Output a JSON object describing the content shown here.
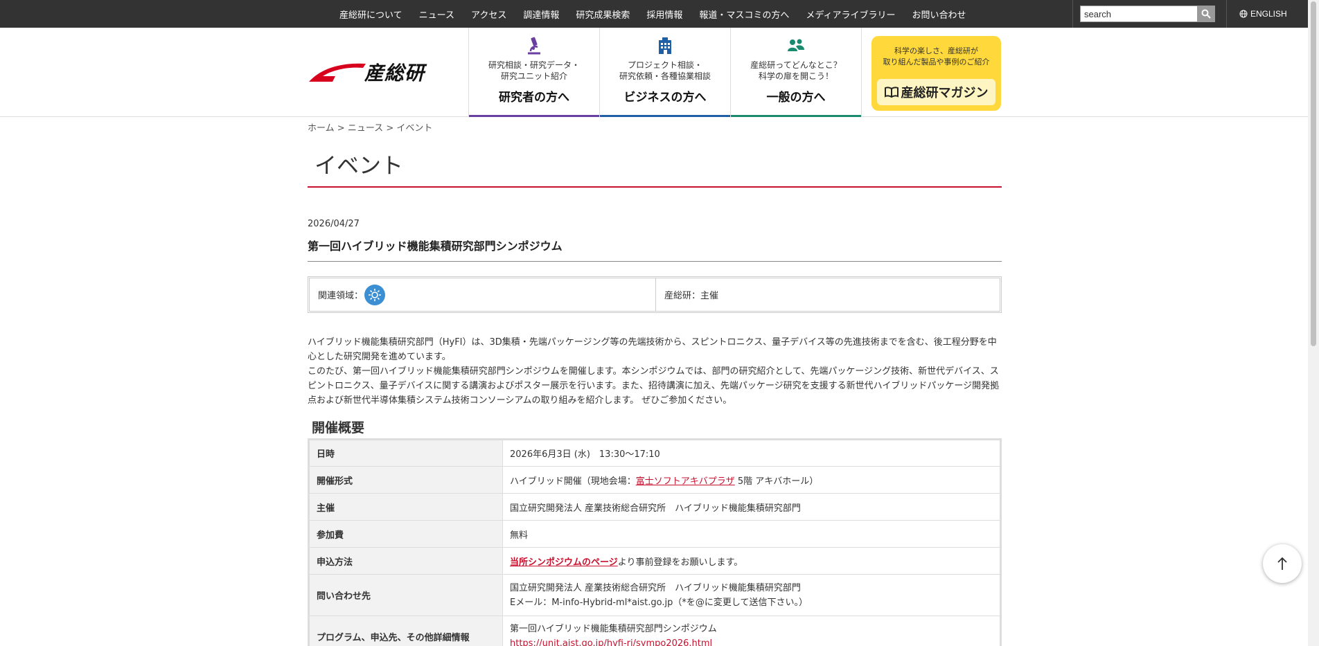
{
  "topnav": {
    "items": [
      "産総研について",
      "ニュース",
      "アクセス",
      "調達情報",
      "研究成果検索",
      "採用情報",
      "報道・マスコミの方へ",
      "メディアライブラリー",
      "お問い合わせ"
    ],
    "search_value": "search",
    "language": "ENGLISH"
  },
  "header": {
    "logo_text": "産総研",
    "cards": [
      {
        "sub1": "研究相談・研究データ・",
        "sub2": "研究ユニット紹介",
        "main": "研究者の方へ",
        "color": "#6b3fa0",
        "icon": "microscope-icon"
      },
      {
        "sub1": "プロジェクト相談・",
        "sub2": "研究依頼・各種協業相談",
        "main": "ビジネスの方へ",
        "color": "#1f5fa6",
        "icon": "building-icon"
      },
      {
        "sub1": "産総研ってどんなとこ？",
        "sub2": "科学の扉を開こう！",
        "main": "一般の方へ",
        "color": "#1a8a6e",
        "icon": "people-icon"
      }
    ],
    "magazine": {
      "line1": "科学の楽しさ、産総研が",
      "line2": "取り組んだ製品や事例のご紹介",
      "title": "産総研マガジン"
    }
  },
  "breadcrumb": {
    "home": "ホーム",
    "news": "ニュース",
    "current": "イベント",
    "sep": ">"
  },
  "page_title": "イベント",
  "event": {
    "date": "2026/04/27",
    "title": "第一回ハイブリッド機能集積研究部門シンポジウム",
    "related_label": "関連領域：",
    "organizer_label": "産総研：主催",
    "intro1": "ハイブリッド機能集積研究部門（HyFI）は、3D集積・先端パッケージング等の先端技術から、スピントロニクス、量子デバイス等の先進技術までを含む、後工程分野を中心とした研究開発を進めています。",
    "intro2": "このたび、第一回ハイブリッド機能集積研究部門シンポジウムを開催します。本シンポジウムでは、部門の研究紹介として、先端パッケージング技術、新世代デバイス、スピントロニクス、量子デバイスに関する講演およびポスター展示を行います。また、招待講演に加え、先端パッケージ研究を支援する新世代ハイブリッドパッケージ開発拠点および新世代半導体集積システム技術コンソーシアムの取り組みを紹介します。 ぜひご参加ください。"
  },
  "overview": {
    "heading": "開催概要",
    "rows": {
      "datetime": {
        "key": "日時",
        "value": "2026年6月3日 (水)　13:30～17:10"
      },
      "format": {
        "key": "開催形式",
        "pre": "ハイブリッド開催（現地会場：",
        "link": "富士ソフトアキバプラザ",
        "post": " 5階 アキバホール）"
      },
      "host": {
        "key": "主催",
        "value": "国立研究開発法人 産業技術総合研究所　ハイブリッド機能集積研究部門"
      },
      "fee": {
        "key": "参加費",
        "value": "無料"
      },
      "apply": {
        "key": "申込方法",
        "link": "当所シンポジウムのページ",
        "post": "より事前登録をお願いします。"
      },
      "contact": {
        "key": "問い合わせ先",
        "line1": "国立研究開発法人 産業技術総合研究所　ハイブリッド機能集積研究部門",
        "line2": "Eメール：M-info-Hybrid-ml*aist.go.jp（*を@に変更して送信下さい。）"
      },
      "program": {
        "key": "プログラム、申込先、その他詳細情報",
        "line1": "第一回ハイブリッド機能集積研究部門シンポジウム",
        "link": "https://unit.aist.go.jp/hyfi-ri/sympo2026.html"
      }
    }
  }
}
